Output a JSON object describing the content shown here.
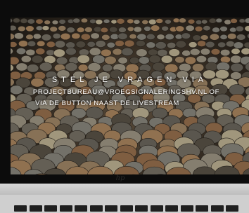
{
  "overlay": {
    "title": "STEL JE VRAGEN VIA",
    "line1": "PROJECTBUREAU@VROEGSIGNALERINGSHV.NL OF",
    "line2": "VIA DE BUTTON NAAST DE LIVESTREAM"
  },
  "brand": {
    "logo_icon": "hp-logo-icon"
  },
  "colors": {
    "text": "#ffffff",
    "bezel": "#0c0c0c",
    "body": "#cfcfcf"
  }
}
